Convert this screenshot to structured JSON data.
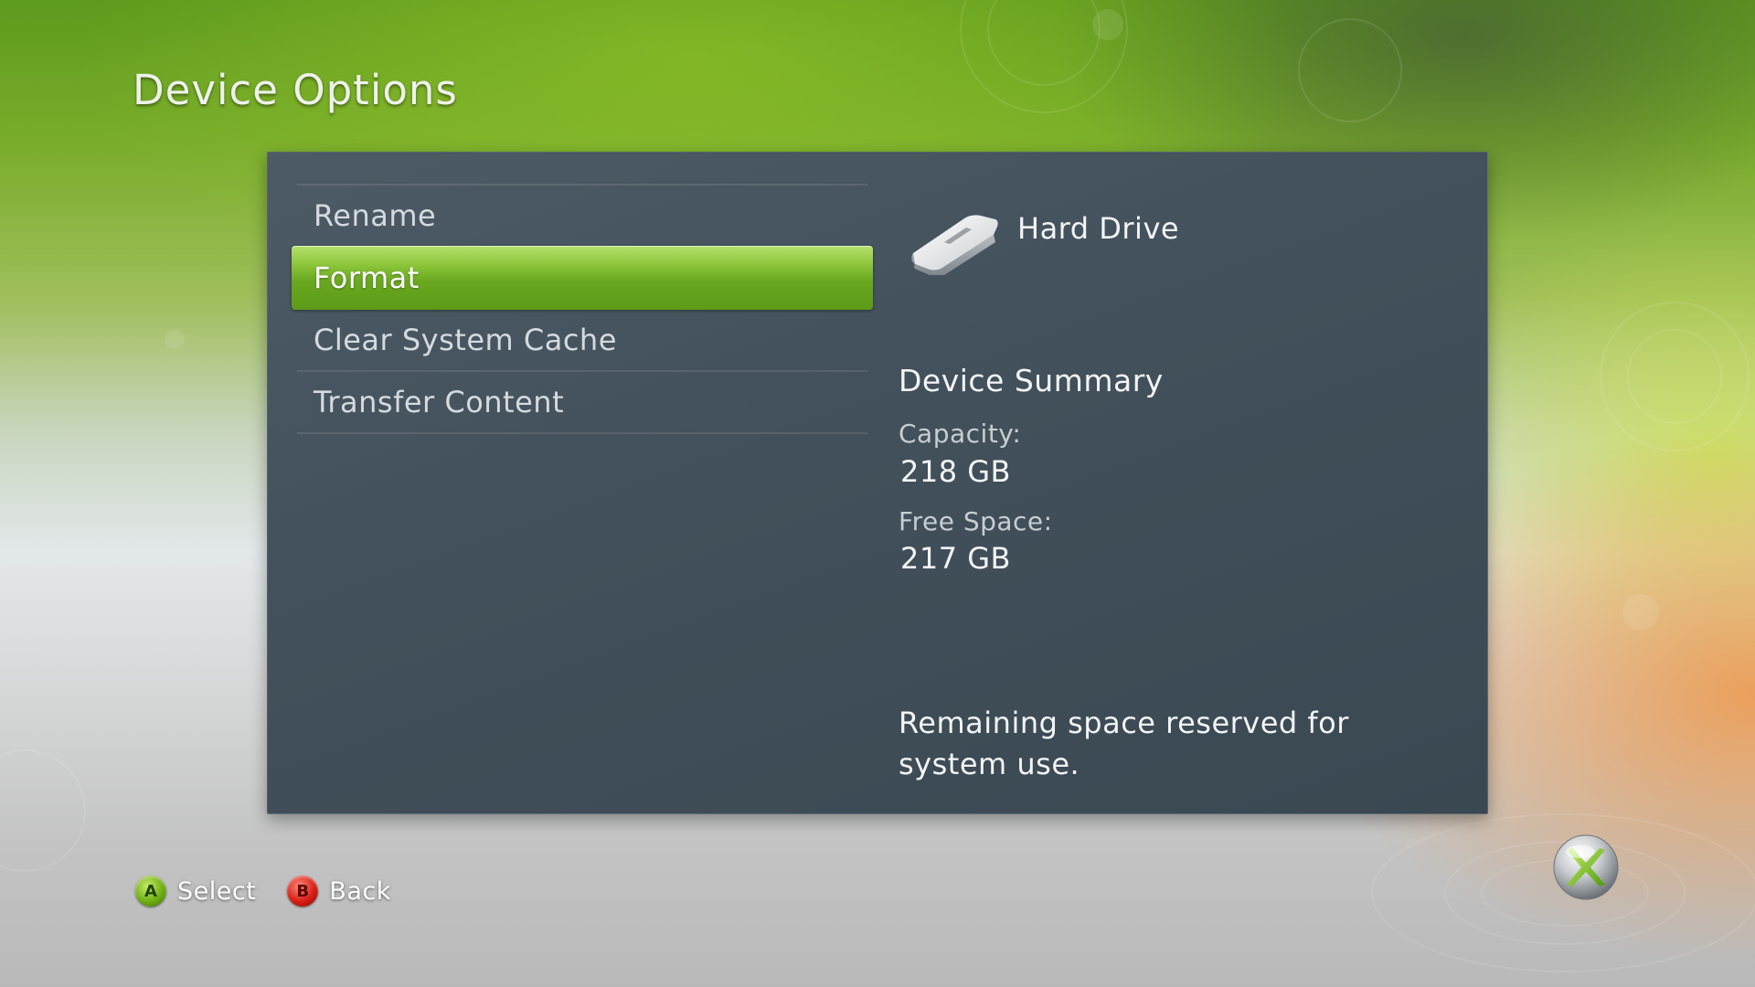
{
  "page": {
    "title": "Device Options"
  },
  "menu": {
    "items": [
      {
        "label": "Rename",
        "selected": false
      },
      {
        "label": "Format",
        "selected": true
      },
      {
        "label": "Clear System Cache",
        "selected": false
      },
      {
        "label": "Transfer Content",
        "selected": false
      }
    ]
  },
  "device": {
    "icon": "hard-drive-icon",
    "name": "Hard Drive",
    "summary_heading": "Device Summary",
    "capacity_label": "Capacity:",
    "capacity_value": "218 GB",
    "free_space_label": "Free Space:",
    "free_space_value": "217 GB",
    "note": "Remaining space reserved for system use."
  },
  "hints": {
    "select_button": "A",
    "select_label": "Select",
    "back_button": "B",
    "back_label": "Back"
  },
  "colors": {
    "selection_green": "#6aa820",
    "panel": "#43515c",
    "a_button": "#6fae14",
    "b_button": "#d81e14"
  }
}
